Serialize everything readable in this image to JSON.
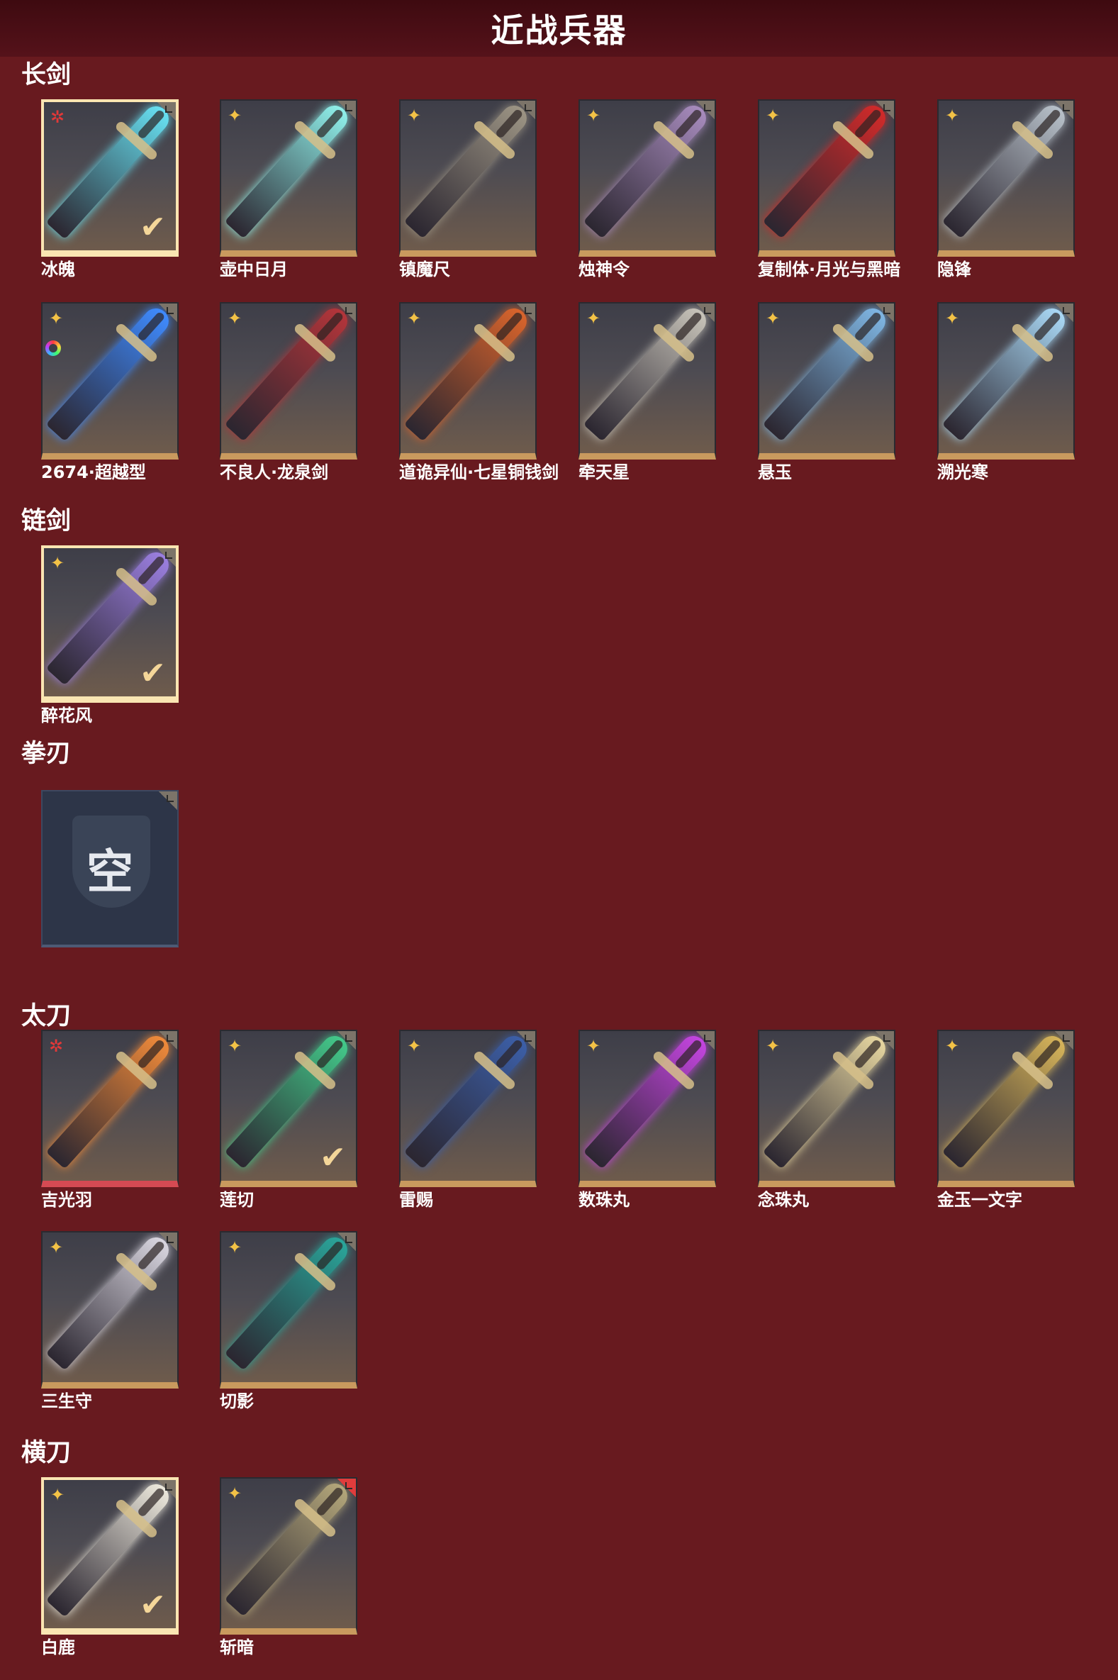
{
  "page_title": "近战兵器",
  "sections": [
    {
      "title": "长剑",
      "items": [
        {
          "name": "冰魄",
          "badge": "red-star",
          "selected": true,
          "blade": "#67e1f2",
          "rainbow": false
        },
        {
          "name": "壶中日月",
          "badge": "gold",
          "selected": false,
          "blade": "#8ff0ea",
          "rainbow": false
        },
        {
          "name": "镇魔尺",
          "badge": "gold",
          "selected": false,
          "blade": "#9c9484",
          "rainbow": false
        },
        {
          "name": "烛神令",
          "badge": "gold",
          "selected": false,
          "blade": "#a78bbd",
          "rainbow": false
        },
        {
          "name": "复制体·月光与黑暗",
          "badge": "gold",
          "selected": false,
          "blade": "#d12a2a",
          "rainbow": false
        },
        {
          "name": "隐锋",
          "badge": "gold",
          "selected": false,
          "blade": "#b7c0c9",
          "rainbow": false
        },
        {
          "name": "2674·超越型",
          "badge": "gold",
          "selected": false,
          "blade": "#3f8bff",
          "rainbow": true
        },
        {
          "name": "不良人·龙泉剑",
          "badge": "gold",
          "selected": false,
          "blade": "#b3353a",
          "rainbow": false
        },
        {
          "name": "道诡异仙·七星铜钱剑",
          "badge": "gold",
          "selected": false,
          "blade": "#d9642c",
          "rainbow": false
        },
        {
          "name": "牵天星",
          "badge": "gold",
          "selected": false,
          "blade": "#c7c3b9",
          "rainbow": false
        },
        {
          "name": "悬玉",
          "badge": "gold",
          "selected": false,
          "blade": "#7fb6e3",
          "rainbow": false
        },
        {
          "name": "溯光寒",
          "badge": "gold",
          "selected": false,
          "blade": "#a9d8f5",
          "rainbow": false
        }
      ]
    },
    {
      "title": "链剑",
      "items": [
        {
          "name": "醉花风",
          "badge": "gold",
          "selected": true,
          "blade": "#9b7fe0",
          "rainbow": false
        }
      ]
    },
    {
      "title": "拳刃",
      "items": [
        {
          "name": "",
          "badge": "none",
          "selected": false,
          "empty": true,
          "empty_label": "空"
        }
      ]
    },
    {
      "title": "太刀",
      "items": [
        {
          "name": "吉光羽",
          "badge": "red-star",
          "selected": false,
          "blade": "#f08a3a",
          "rainbow": false,
          "red_bottom": true
        },
        {
          "name": "莲切",
          "badge": "gold",
          "selected": false,
          "blade": "#43c98a",
          "rainbow": false,
          "checked": true
        },
        {
          "name": "雷赐",
          "badge": "gold",
          "selected": false,
          "blade": "#3c5fa8",
          "rainbow": false
        },
        {
          "name": "数珠丸",
          "badge": "gold",
          "selected": false,
          "blade": "#c445e0",
          "rainbow": false
        },
        {
          "name": "念珠丸",
          "badge": "gold",
          "selected": false,
          "blade": "#e6d6a0",
          "rainbow": false
        },
        {
          "name": "金玉一文字",
          "badge": "gold",
          "selected": false,
          "blade": "#d6b45a",
          "rainbow": false
        },
        {
          "name": "三生守",
          "badge": "gold",
          "selected": false,
          "blade": "#d9d6e0",
          "rainbow": false
        },
        {
          "name": "切影",
          "badge": "gold",
          "selected": false,
          "blade": "#2aa59a",
          "rainbow": false
        }
      ]
    },
    {
      "title": "横刀",
      "items": [
        {
          "name": "白鹿",
          "badge": "gold",
          "selected": true,
          "blade": "#ece8dc",
          "rainbow": false
        },
        {
          "name": "斩暗",
          "badge": "gold",
          "selected": false,
          "blade": "#b3a67a",
          "rainbow": false,
          "red_corner": true
        }
      ]
    }
  ]
}
